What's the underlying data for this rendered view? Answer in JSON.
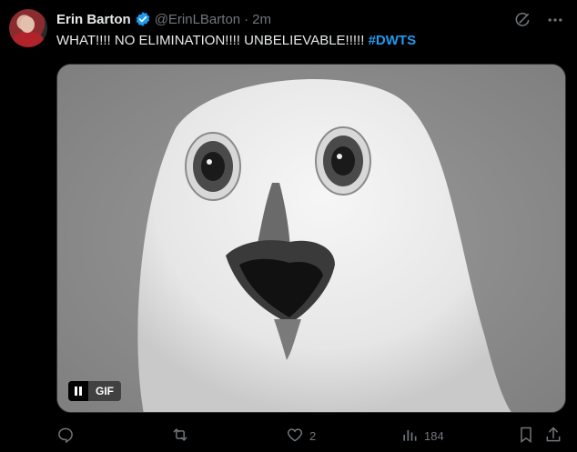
{
  "tweet": {
    "author_name": "Erin Barton",
    "handle": "@ErinLBarton",
    "separator": "·",
    "time": "2m",
    "text_main": "WHAT!!!! NO ELIMINATION!!!! UNBELIEVABLE!!!!!",
    "hashtag": "#DWTS"
  },
  "media": {
    "gif_label": "GIF"
  },
  "actions": {
    "reply_count": "",
    "retweet_count": "",
    "like_count": "2",
    "views_count": "184"
  },
  "colors": {
    "background": "#000000",
    "text": "#e7e9ea",
    "secondary": "#71767b",
    "accent": "#1d9bf0"
  },
  "icons": [
    "grok-icon",
    "more-icon",
    "verified-icon",
    "pause-icon",
    "reply-icon",
    "retweet-icon",
    "like-icon",
    "views-icon",
    "bookmark-icon",
    "share-icon"
  ]
}
